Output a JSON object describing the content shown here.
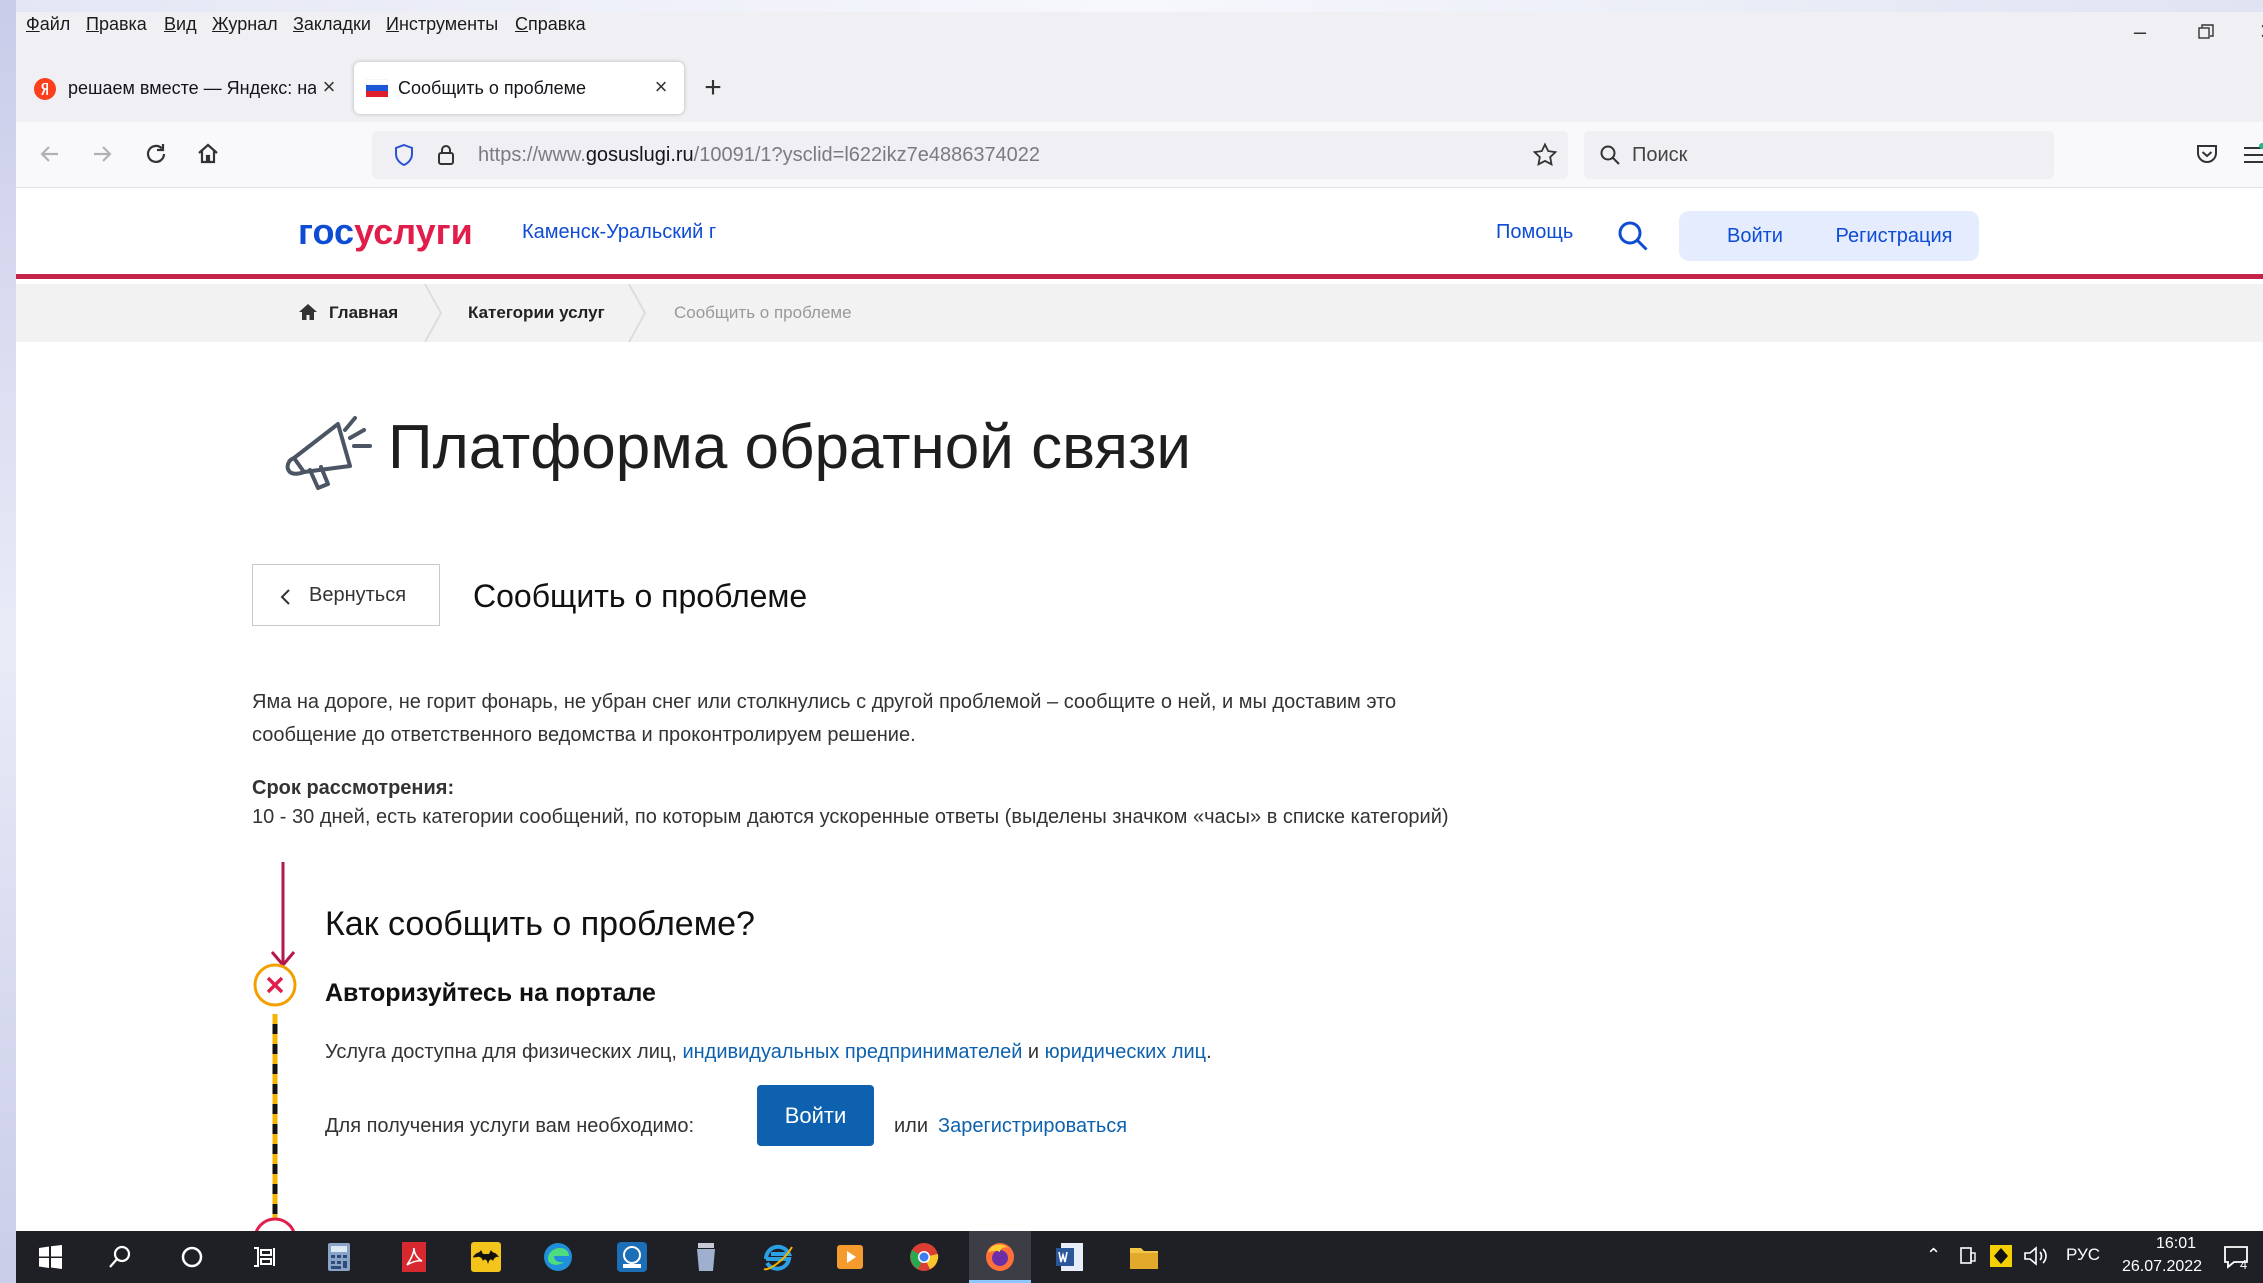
{
  "menu": [
    "Файл",
    "Правка",
    "Вид",
    "Журнал",
    "Закладки",
    "Инструменты",
    "Справка"
  ],
  "tabs": [
    {
      "title": "решаем вместе — Яндекс: нашлось"
    },
    {
      "title": "Сообщить о проблеме"
    }
  ],
  "url": {
    "prefix": "https://www.",
    "domain": "gosuslugi.ru",
    "path": "/10091/1?ysclid=l622ikz7e4886374022"
  },
  "search_placeholder": "Поиск",
  "site": {
    "logo_a": "гос",
    "logo_b": "услуги",
    "region": "Каменск-Уральский г",
    "help": "Помощь",
    "login": "Войти",
    "register": "Регистрация"
  },
  "breadcrumbs": [
    "Главная",
    "Категории услуг",
    "Сообщить о проблеме"
  ],
  "page": {
    "title": "Платформа обратной связи",
    "back": "Вернуться",
    "subtitle": "Сообщить о проблеме",
    "intro": "Яма на дороге, не горит фонарь, не убран снег или столкнулись с другой проблемой – сообщите о ней, и мы доставим это сообщение до ответственного ведомства и проконтролируем решение.",
    "term_label": "Срок рассмотрения:",
    "term_text": "10 - 30 дней, есть категории сообщений, по которым даются ускоренные ответы (выделены значком «часы» в списке категорий)",
    "how_title": "Как сообщить о проблеме?",
    "step1_title": "Авторизуйтесь на портале",
    "step1_text_a": "Услуга доступна для физических лиц, ",
    "step1_link1": "индивидуальных предпринимателей",
    "step1_and": " и ",
    "step1_link2": "юридических лиц",
    "step1_dot": ".",
    "need_text": "Для получения услуги вам необходимо:",
    "login_btn": "Войти",
    "or": "или",
    "register_link": "Зарегистрироваться"
  },
  "taskbar": {
    "lang": "РУС",
    "time": "16:01",
    "date": "26.07.2022",
    "notif_count": "4"
  },
  "colors": {
    "brand_blue": "#0d4cd3",
    "brand_red": "#e11e4b",
    "accent": "#0d61af",
    "step_ring": "#f2a000"
  }
}
